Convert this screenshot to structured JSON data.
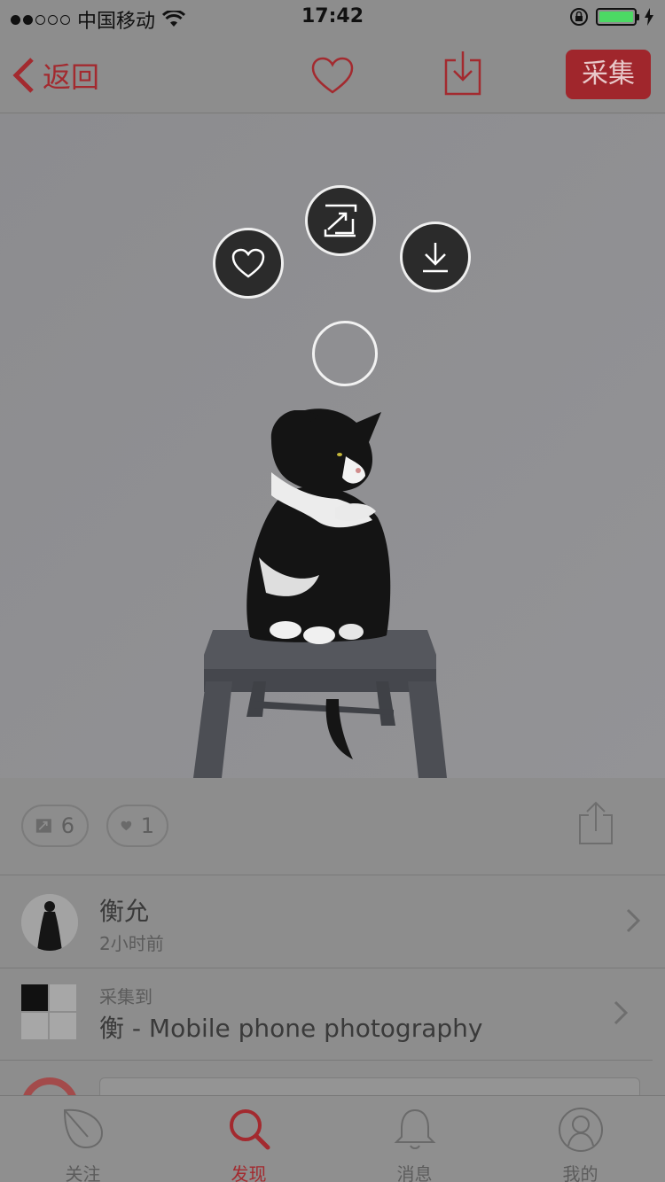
{
  "status_bar": {
    "carrier": "中国移动",
    "time": "17:42"
  },
  "nav": {
    "back_label": "返回",
    "collect_label": "采集"
  },
  "stats": {
    "repin_count": "6",
    "like_count": "1"
  },
  "author": {
    "name": "衡允",
    "time_ago": "2小时前"
  },
  "board": {
    "caption": "采集到",
    "title": "衡  -  Mobile phone photography"
  },
  "tabs": [
    {
      "label": "关注",
      "icon": "leaf-icon",
      "active": false
    },
    {
      "label": "发现",
      "icon": "search-icon",
      "active": true
    },
    {
      "label": "消息",
      "icon": "bell-icon",
      "active": false
    },
    {
      "label": "我的",
      "icon": "person-icon",
      "active": false
    }
  ],
  "colors": {
    "accent": "#a32a2f",
    "overlay": "#8d8d8d"
  }
}
